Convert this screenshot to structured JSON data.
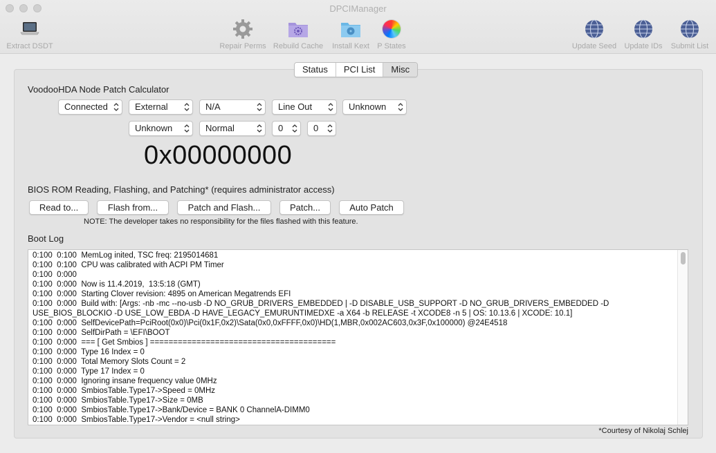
{
  "window": {
    "title": "DPCIManager"
  },
  "toolbar": {
    "items": [
      {
        "label": "Extract DSDT",
        "icon": "laptop-icon"
      },
      {
        "label": "Repair Perms",
        "icon": "gear-icon"
      },
      {
        "label": "Rebuild Cache",
        "icon": "folder-gear-icon"
      },
      {
        "label": "Install Kext",
        "icon": "folder-radiation-icon"
      },
      {
        "label": "P States",
        "icon": "color-wheel-icon"
      },
      {
        "label": "Update Seed",
        "icon": "globe-icon"
      },
      {
        "label": "Update IDs",
        "icon": "globe-icon"
      },
      {
        "label": "Submit List",
        "icon": "globe-icon"
      }
    ]
  },
  "tabs": {
    "items": [
      {
        "label": "Status"
      },
      {
        "label": "PCI List"
      },
      {
        "label": "Misc"
      }
    ],
    "selected": "Misc"
  },
  "calculator": {
    "title": "VoodooHDA Node Patch Calculator",
    "row1": [
      "Connected",
      "External",
      "N/A",
      "Line Out",
      "Unknown"
    ],
    "row2": [
      "Unknown",
      "Normal",
      "0",
      "0"
    ],
    "result": "0x00000000"
  },
  "bios": {
    "title": "BIOS ROM Reading, Flashing, and Patching* (requires administrator access)",
    "buttons": [
      "Read to...",
      "Flash from...",
      "Patch and Flash...",
      "Patch...",
      "Auto Patch"
    ],
    "note": "NOTE: The developer takes no responsibility for the files flashed with this feature."
  },
  "bootlog": {
    "title": "Boot Log",
    "lines": [
      "0:100  0:100  MemLog inited, TSC freq: 2195014681",
      "0:100  0:100  CPU was calibrated with ACPI PM Timer",
      "0:100  0:000",
      "0:100  0:000  Now is 11.4.2019,  13:5:18 (GMT)",
      "0:100  0:000  Starting Clover revision: 4895 on American Megatrends EFI",
      "0:100  0:000  Build with: [Args: -nb -mc --no-usb -D NO_GRUB_DRIVERS_EMBEDDED | -D DISABLE_USB_SUPPORT -D NO_GRUB_DRIVERS_EMBEDDED -D USE_BIOS_BLOCKIO -D USE_LOW_EBDA -D HAVE_LEGACY_EMURUNTIMEDXE -a X64 -b RELEASE -t XCODE8 -n 5 | OS: 10.13.6 | XCODE: 10.1]",
      "0:100  0:000  SelfDevicePath=PciRoot(0x0)\\Pci(0x1F,0x2)\\Sata(0x0,0xFFFF,0x0)\\HD(1,MBR,0x002AC603,0x3F,0x100000) @24E4518",
      "0:100  0:000  SelfDirPath = \\EFI\\BOOT",
      "0:100  0:000  === [ Get Smbios ] ========================================",
      "0:100  0:000  Type 16 Index = 0",
      "0:100  0:000  Total Memory Slots Count = 2",
      "0:100  0:000  Type 17 Index = 0",
      "0:100  0:000  Ignoring insane frequency value 0MHz",
      "0:100  0:000  SmbiosTable.Type17->Speed = 0MHz",
      "0:100  0:000  SmbiosTable.Type17->Size = 0MB",
      "0:100  0:000  SmbiosTable.Type17->Bank/Device = BANK 0 ChannelA-DIMM0",
      "0:100  0:000  SmbiosTable.Type17->Vendor = <null string>"
    ]
  },
  "courtesy": "*Courtesy of Nikolaj Schlej"
}
